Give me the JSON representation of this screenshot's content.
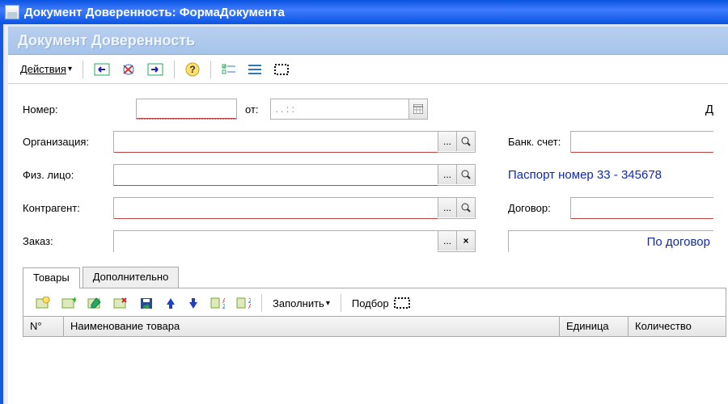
{
  "titlebar": {
    "title": "Документ Доверенность: ФормаДокумента"
  },
  "subheader": {
    "title": "Документ Доверенность"
  },
  "toolbar": {
    "actions_label": "Действия",
    "icons": [
      "nav-back",
      "refresh",
      "nav-forward",
      "help",
      "list-check",
      "list-lines",
      "dotted-rect"
    ]
  },
  "form": {
    "number_label": "Номер:",
    "number_value": "",
    "from_label": "от:",
    "date_value": " .  .      :  :",
    "org_label": "Организация:",
    "org_value": "",
    "person_label": "Физ. лицо:",
    "person_value": "",
    "contragent_label": "Контрагент:",
    "contragent_value": "",
    "order_label": "Заказ:",
    "order_value": "",
    "right_top_fragment": "Д",
    "bank_label": "Банк. счет:",
    "bank_value": "",
    "passport_text": "Паспорт  номер 33 - 345678",
    "contract_label": "Договор:",
    "contract_value": "",
    "by_contract": "По договор"
  },
  "tabs": {
    "items": [
      {
        "label": "Товары",
        "active": true
      },
      {
        "label": "Дополнительно",
        "active": false
      }
    ],
    "fill_label": "Заполнить",
    "select_label": "Подбор"
  },
  "grid": {
    "columns": [
      "N°",
      "Наименование товара",
      "Единица",
      "Количество"
    ]
  }
}
